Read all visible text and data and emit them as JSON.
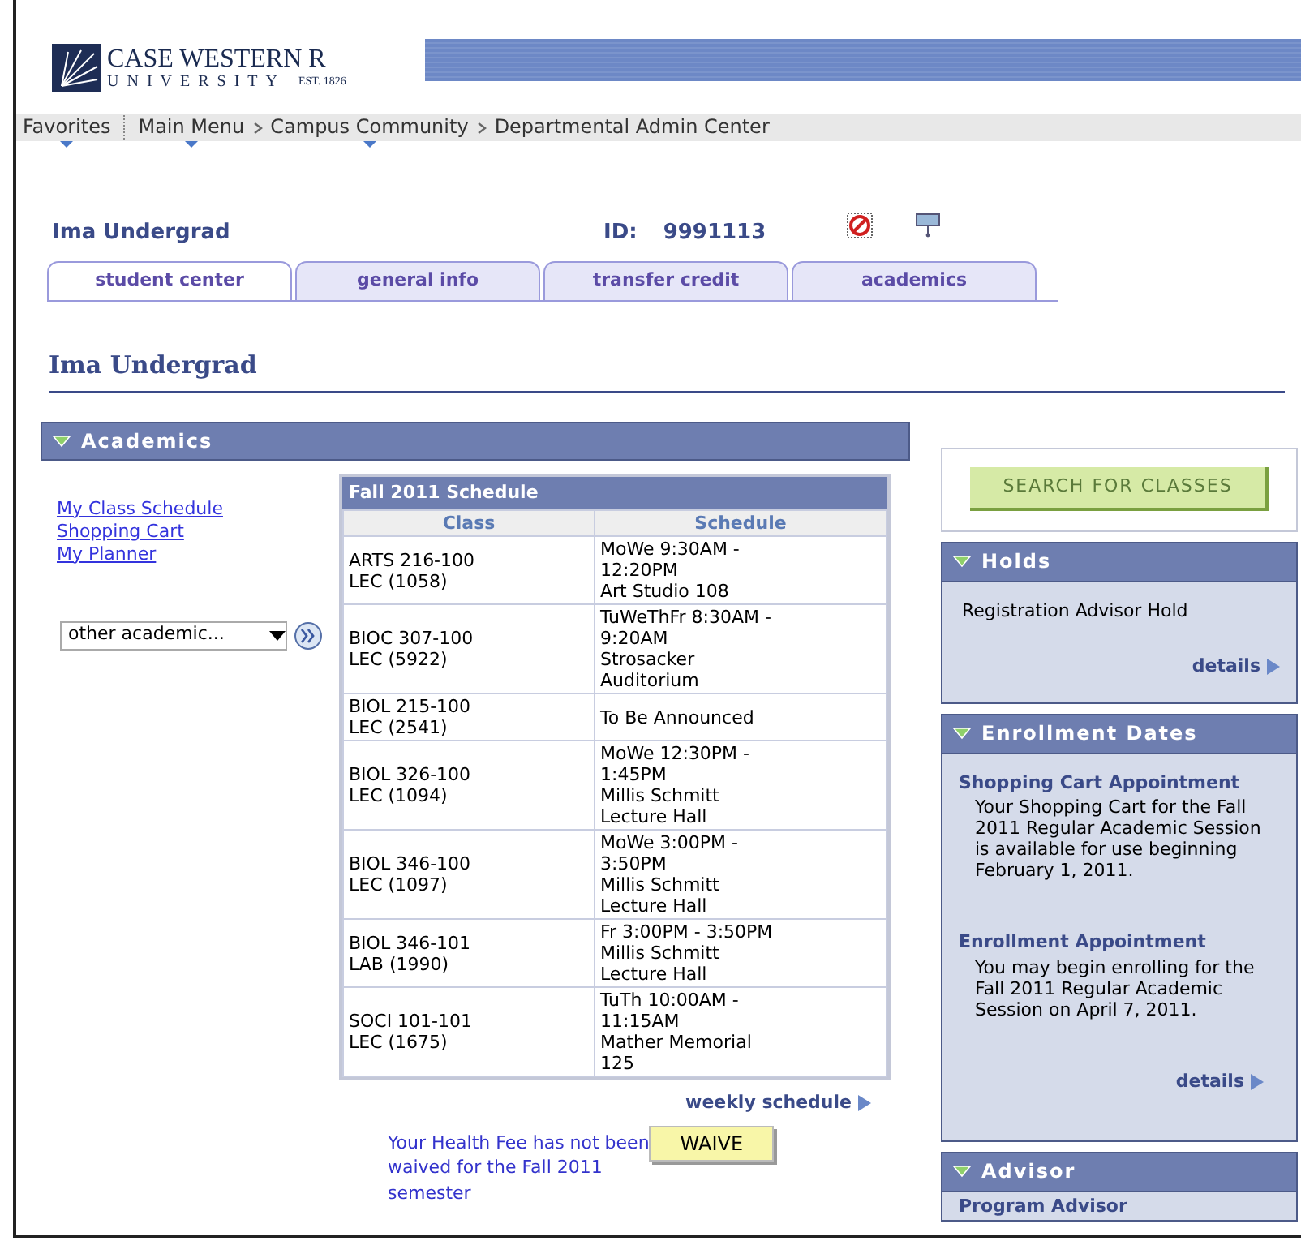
{
  "header": {
    "logo_name": "CASE WESTERN R",
    "logo_sub": "UNIVERSITY",
    "logo_est": "EST. 1826"
  },
  "breadcrumbs": [
    {
      "label": "Favorites",
      "menu": true
    },
    {
      "label": "Main Menu",
      "menu": true
    },
    {
      "label": "Campus Community",
      "menu": true
    },
    {
      "label": "Departmental Admin Center",
      "menu": false
    }
  ],
  "student": {
    "name": "Ima Undergrad",
    "id_label": "ID:",
    "id": "9991113"
  },
  "tabs": [
    {
      "label": "student center",
      "selected": true
    },
    {
      "label": "general info",
      "selected": false
    },
    {
      "label": "transfer credit",
      "selected": false
    },
    {
      "label": "academics",
      "selected": false
    }
  ],
  "page_title": "Ima Undergrad",
  "academics": {
    "title": "Academics",
    "expanded": true,
    "links": [
      "My Class Schedule",
      "Shopping Cart",
      "My Planner"
    ],
    "select": {
      "value": "other academic..."
    },
    "schedule": {
      "title": "Fall 2011 Schedule",
      "columns": [
        "Class",
        "Schedule"
      ],
      "rows": [
        {
          "class": "ARTS 216-100\nLEC (1058)",
          "schedule": "MoWe 9:30AM -\n12:20PM\nArt Studio 108"
        },
        {
          "class": "BIOC 307-100\nLEC (5922)",
          "schedule": "TuWeThFr 8:30AM -\n9:20AM\nStrosacker\nAuditorium"
        },
        {
          "class": "BIOL 215-100\nLEC (2541)",
          "schedule": "To Be Announced"
        },
        {
          "class": "BIOL 326-100\nLEC (1094)",
          "schedule": "MoWe 12:30PM -\n1:45PM\nMillis Schmitt\nLecture Hall"
        },
        {
          "class": "BIOL 346-100\nLEC (1097)",
          "schedule": "MoWe 3:00PM -\n3:50PM\nMillis Schmitt\nLecture Hall"
        },
        {
          "class": "BIOL 346-101\nLAB (1990)",
          "schedule": "Fr 3:00PM - 3:50PM\nMillis Schmitt\nLecture Hall"
        },
        {
          "class": "SOCI 101-101\nLEC (1675)",
          "schedule": "TuTh 10:00AM -\n11:15AM\nMather Memorial\n125"
        }
      ],
      "link": "weekly schedule"
    },
    "health_fee": {
      "message": "Your Health Fee has not been\nwaived for the Fall 2011",
      "message_end": "semester",
      "button": "WAIVE"
    }
  },
  "search_button": "SEARCH FOR CLASSES",
  "holds": {
    "title": "Holds",
    "expanded": true,
    "items": [
      "Registration Advisor Hold"
    ],
    "link": "details"
  },
  "enrollment_dates": {
    "title": "Enrollment Dates",
    "expanded": true,
    "sections": [
      {
        "title": "Shopping Cart Appointment",
        "text": "Your Shopping Cart for the Fall 2011 Regular Academic Session is available for use beginning February 1, 2011."
      },
      {
        "title": "Enrollment Appointment",
        "text": "You may begin enrolling for the Fall 2011 Regular Academic Session on April 7, 2011."
      }
    ],
    "link": "details"
  },
  "advisor": {
    "title": "Advisor",
    "expanded": true,
    "label": "Program Advisor"
  }
}
